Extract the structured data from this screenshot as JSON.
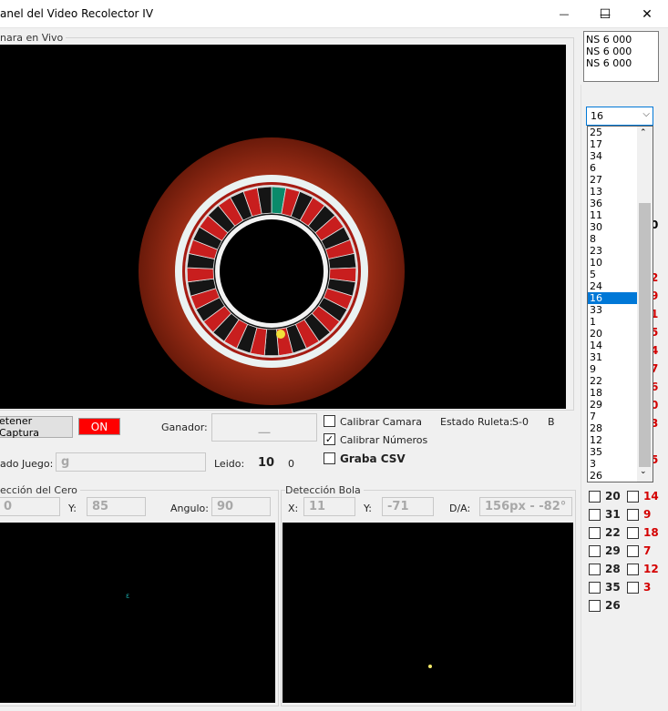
{
  "window": {
    "title": "anel del Video Recolector IV",
    "minimize": "—",
    "maximize": "☐",
    "close": "✕"
  },
  "camera": {
    "group_label": "nara en Vivo"
  },
  "info_lines": [
    "NS  6 000",
    "NS  6 000",
    "NS  6 000"
  ],
  "combo": {
    "value": "16",
    "arrow": "⌵"
  },
  "dropdown_options": [
    "25",
    "17",
    "34",
    "6",
    "27",
    "13",
    "36",
    "11",
    "30",
    "8",
    "23",
    "10",
    "5",
    "24",
    "16",
    "33",
    "1",
    "20",
    "14",
    "31",
    "9",
    "22",
    "18",
    "29",
    "7",
    "28",
    "12",
    "35",
    "3",
    "26"
  ],
  "dropdown_selected": "16",
  "controls": {
    "detener_label": "etener Captura",
    "on_label": "ON",
    "ganador_label": "Ganador:",
    "ganador_value": "__",
    "calibrar_camara": "Calibrar Camara",
    "calibrar_numeros": "Calibrar Números",
    "graba_csv": "Graba CSV",
    "estado_ruleta_label": "Estado Ruleta:",
    "estado_ruleta_value": "S-0",
    "estado_ruleta_extra": "B",
    "estado_juego_label": "ado Juego:",
    "estado_juego_value": "g",
    "leido_label": "Leido:",
    "leido_value": "10",
    "leido_extra": "0"
  },
  "deteccion_cero": {
    "group_label": "ección del Cero",
    "x_value": "0",
    "y_label": "Y:",
    "y_value": "85",
    "angulo_label": "Angulo:",
    "angulo_value": "90"
  },
  "deteccion_bola": {
    "group_label": "Detección Bola",
    "x_label": "X:",
    "x_value": "11",
    "y_label": "Y:",
    "y_value": "-71",
    "da_label": "D/A:",
    "da_value": "156px - -82°"
  },
  "number_rows": [
    {
      "left": "20",
      "right": "14"
    },
    {
      "left": "31",
      "right": "9"
    },
    {
      "left": "22",
      "right": "18"
    },
    {
      "left": "29",
      "right": "7"
    },
    {
      "left": "28",
      "right": "12"
    },
    {
      "left": "35",
      "right": "3"
    },
    {
      "left": "26",
      "right": ""
    }
  ],
  "side_fragments": [
    "0",
    "2",
    "9",
    "1",
    "5",
    "4",
    "7",
    "6",
    "0",
    "3",
    "5"
  ],
  "colors": {
    "accent": "#0078d7",
    "on_bg": "#ff0000",
    "red_number": "#d40000"
  }
}
